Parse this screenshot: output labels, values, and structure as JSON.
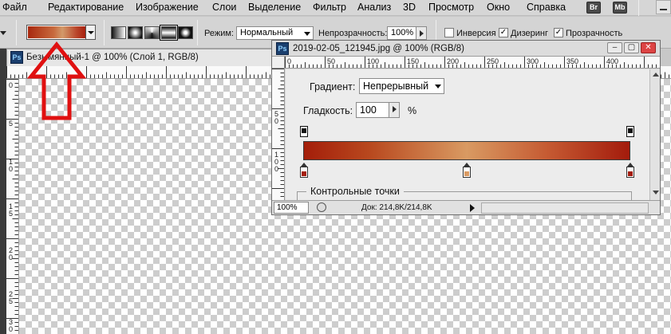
{
  "menu": {
    "items": [
      "Файл",
      "Редактирование",
      "Изображение",
      "Слои",
      "Выделение",
      "Фильтр",
      "Анализ",
      "3D",
      "Просмотр",
      "Окно",
      "Справка"
    ],
    "app_buttons": [
      "Br",
      "Mb"
    ]
  },
  "options": {
    "mode_label": "Режим:",
    "mode_value": "Нормальный",
    "opacity_label": "Непрозрачность:",
    "opacity_value": "100%",
    "inversion_label": "Инверсия",
    "inversion_checked": false,
    "dither_label": "Дизеринг",
    "dither_checked": true,
    "transparency_label": "Прозрачность",
    "transparency_checked": true,
    "gradient_colors": [
      "#a8280e",
      "#d39a6a",
      "#a8200e"
    ]
  },
  "document": {
    "tab_title": "Безымянный-1 @ 100% (Слой 1, RGB/8)",
    "ruler_v_labels": [
      "0",
      "5",
      "1",
      "0",
      "1",
      "5",
      "2",
      "0",
      "2",
      "5",
      "3",
      "0"
    ]
  },
  "window": {
    "title": "2019-02-05_121945.jpg @ 100% (RGB/8)",
    "ruler_h_labels": [
      "0",
      "50",
      "100",
      "150",
      "200",
      "250",
      "300",
      "350",
      "400"
    ],
    "ruler_v_labels": [
      "5",
      "0",
      "1",
      "0",
      "0"
    ],
    "gradient_label": "Градиент:",
    "gradient_type": "Непрерывный",
    "smoothness_label": "Гладкость:",
    "smoothness_value": "100",
    "smoothness_unit": "%",
    "control_points_label": "Контрольные точки",
    "stop_colors": [
      "#a41e0a",
      "#d99a62",
      "#a31b0c"
    ],
    "zoom": "100%",
    "doc_info": "Док: 214,8K/214,8K"
  }
}
